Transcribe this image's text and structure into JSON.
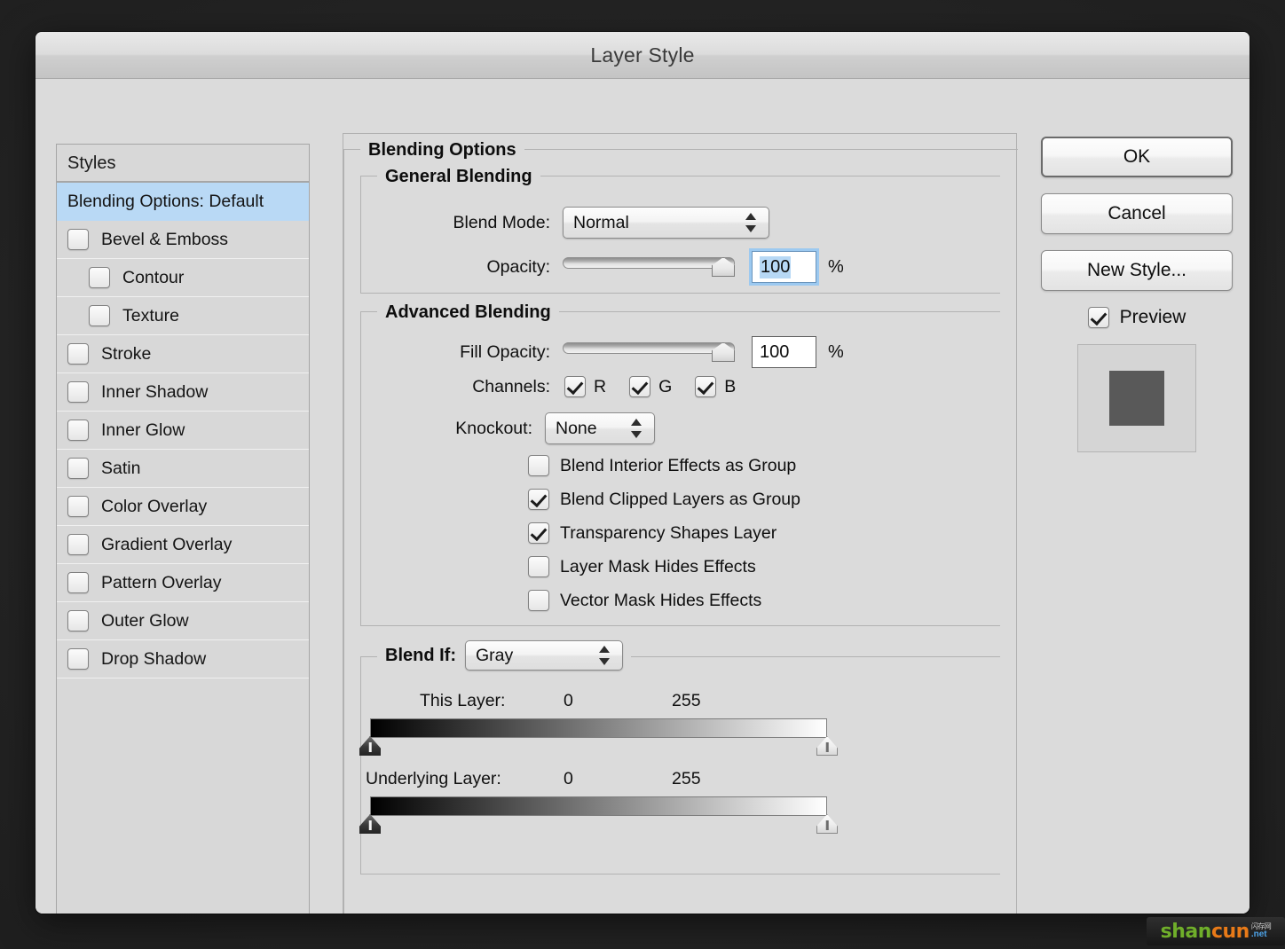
{
  "window": {
    "title": "Layer Style"
  },
  "sidebar": {
    "header": "Styles",
    "items": [
      {
        "label": "Blending Options: Default",
        "selected": true,
        "checkbox": false,
        "indent": false
      },
      {
        "label": "Bevel & Emboss",
        "selected": false,
        "checkbox": true,
        "checked": false,
        "indent": false
      },
      {
        "label": "Contour",
        "selected": false,
        "checkbox": true,
        "checked": false,
        "indent": true
      },
      {
        "label": "Texture",
        "selected": false,
        "checkbox": true,
        "checked": false,
        "indent": true
      },
      {
        "label": "Stroke",
        "selected": false,
        "checkbox": true,
        "checked": false,
        "indent": false
      },
      {
        "label": "Inner Shadow",
        "selected": false,
        "checkbox": true,
        "checked": false,
        "indent": false
      },
      {
        "label": "Inner Glow",
        "selected": false,
        "checkbox": true,
        "checked": false,
        "indent": false
      },
      {
        "label": "Satin",
        "selected": false,
        "checkbox": true,
        "checked": false,
        "indent": false
      },
      {
        "label": "Color Overlay",
        "selected": false,
        "checkbox": true,
        "checked": false,
        "indent": false
      },
      {
        "label": "Gradient Overlay",
        "selected": false,
        "checkbox": true,
        "checked": false,
        "indent": false
      },
      {
        "label": "Pattern Overlay",
        "selected": false,
        "checkbox": true,
        "checked": false,
        "indent": false
      },
      {
        "label": "Outer Glow",
        "selected": false,
        "checkbox": true,
        "checked": false,
        "indent": false
      },
      {
        "label": "Drop Shadow",
        "selected": false,
        "checkbox": true,
        "checked": false,
        "indent": false
      }
    ]
  },
  "main": {
    "group_title": "Blending Options",
    "general": {
      "legend": "General Blending",
      "blend_mode_label": "Blend Mode:",
      "blend_mode_value": "Normal",
      "opacity_label": "Opacity:",
      "opacity_value": "100",
      "opacity_percent": "%",
      "opacity_slider_pct": 100
    },
    "advanced": {
      "legend": "Advanced Blending",
      "fill_opacity_label": "Fill Opacity:",
      "fill_opacity_value": "100",
      "fill_opacity_percent": "%",
      "fill_opacity_slider_pct": 100,
      "channels_label": "Channels:",
      "channels": [
        {
          "label": "R",
          "checked": true
        },
        {
          "label": "G",
          "checked": true
        },
        {
          "label": "B",
          "checked": true
        }
      ],
      "knockout_label": "Knockout:",
      "knockout_value": "None",
      "options": [
        {
          "label": "Blend Interior Effects as Group",
          "checked": false
        },
        {
          "label": "Blend Clipped Layers as Group",
          "checked": true
        },
        {
          "label": "Transparency Shapes Layer",
          "checked": true
        },
        {
          "label": "Layer Mask Hides Effects",
          "checked": false
        },
        {
          "label": "Vector Mask Hides Effects",
          "checked": false
        }
      ]
    },
    "blend_if": {
      "legend": "Blend If:",
      "channel_value": "Gray",
      "this_layer": {
        "label": "This Layer:",
        "min": "0",
        "max": "255",
        "min_pos_pct": 0,
        "max_pos_pct": 100
      },
      "underlying_layer": {
        "label": "Underlying Layer:",
        "min": "0",
        "max": "255",
        "min_pos_pct": 0,
        "max_pos_pct": 100
      }
    }
  },
  "buttons": {
    "ok": "OK",
    "cancel": "Cancel",
    "new_style": "New Style...",
    "preview_label": "Preview",
    "preview_checked": true
  },
  "watermark": {
    "part1": "shan",
    "part2": "cun",
    "cn": "闪存网",
    "net": ".net"
  },
  "colors": {
    "selection_blue": "#b9d9f5",
    "field_focus_blue": "#9cc9f0",
    "dialog_bg": "#dbdbdb",
    "thumb_swatch": "#595959"
  }
}
